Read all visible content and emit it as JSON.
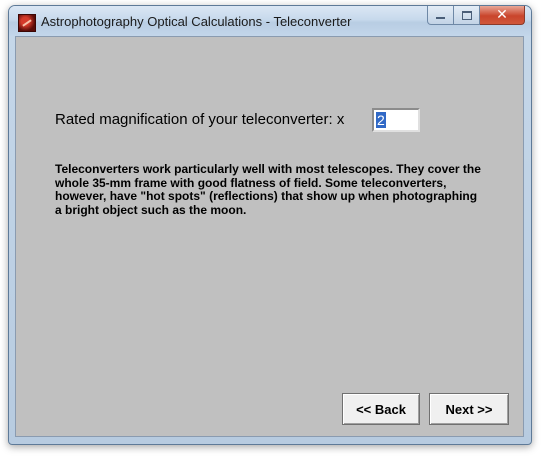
{
  "window": {
    "title": "Astrophotography Optical Calculations - Teleconverter",
    "close_glyph": "✕"
  },
  "form": {
    "magnification_label": "Rated magnification of your teleconverter:  x",
    "magnification_value": "2"
  },
  "description": "Teleconverters work particularly well with most telescopes.  They cover the whole 35-mm frame with good flatness of field.  Some teleconverters, however, have \"hot spots\" (reflections) that show up when photographing a bright object such as the moon.",
  "buttons": {
    "back_label": "<< Back",
    "next_label": "Next >>"
  },
  "colors": {
    "client_background": "#c0c0c0",
    "selection": "#3169c6",
    "close_button": "#c9452c"
  },
  "icons": {
    "app": "app-icon",
    "minimize": "minimize-icon",
    "maximize": "maximize-icon",
    "close": "close-icon"
  }
}
